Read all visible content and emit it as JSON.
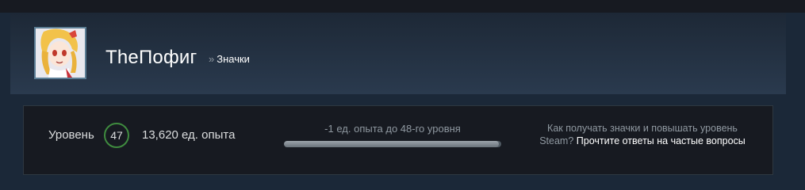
{
  "profile": {
    "name": "TheПофиг",
    "breadcrumb_separator": "»",
    "breadcrumb_current": "Значки"
  },
  "level_panel": {
    "level_label": "Уровень",
    "level": "47",
    "xp_total": "13,620 ед. опыта",
    "xp_to_next": "-1 ед. опыта до 48-го уровня",
    "progress_fraction": 0.99,
    "faq_text": "Как получать значки и повышать уровень Steam?",
    "faq_link": "Прочтите ответы на частые вопросы"
  },
  "colors": {
    "page_bg": "#1b2838",
    "level_ring": "#3f8b3f",
    "muted_text": "#8f98a0"
  },
  "icons": {
    "avatar": "anime-girl-avatar"
  }
}
